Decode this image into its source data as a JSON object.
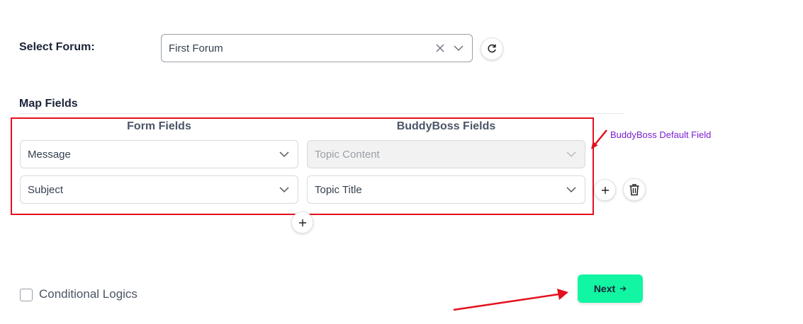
{
  "forum": {
    "label": "Select Forum:",
    "selected": "First Forum"
  },
  "map_fields": {
    "title": "Map Fields",
    "form_fields_header": "Form Fields",
    "buddyboss_fields_header": "BuddyBoss Fields",
    "rows": [
      {
        "form_field": "Message",
        "buddyboss_field": "Topic Content",
        "buddyboss_disabled": true
      },
      {
        "form_field": "Subject",
        "buddyboss_field": "Topic Title",
        "buddyboss_disabled": false
      }
    ]
  },
  "annotation": {
    "text": "BuddyBoss Default Field",
    "color": "#7b1fd1",
    "arrow_color": "#e3101e"
  },
  "conditional": {
    "label": "Conditional Logics",
    "checked": false
  },
  "next_button": {
    "label": "Next",
    "color": "#12f5a3"
  },
  "icons": {
    "clear": "x-icon",
    "dropdown": "chevron-down-icon",
    "refresh": "refresh-icon",
    "add": "plus-icon",
    "delete": "trash-icon",
    "next": "arrow-right-icon"
  }
}
